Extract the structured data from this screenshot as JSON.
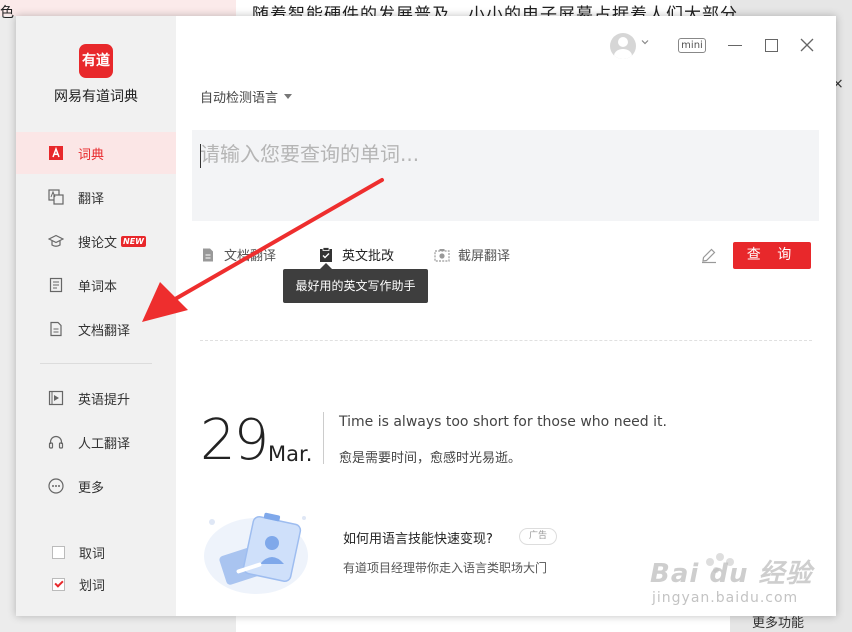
{
  "background": {
    "corner_char": "色",
    "doc_text": "随着智能硬件的发展普及，小小的电子屏幕占据着人们大部分",
    "right_x": "×",
    "bottom_right": "更多功能"
  },
  "app": {
    "logo_text": "有道",
    "name": "网易有道词典"
  },
  "sidebar": {
    "items": [
      {
        "label": "词典",
        "icon": "dictionary-icon"
      },
      {
        "label": "翻译",
        "icon": "translate-icon"
      },
      {
        "label": "搜论文",
        "icon": "graduation-cap-icon",
        "badge": "NEW"
      },
      {
        "label": "单词本",
        "icon": "wordbook-icon"
      },
      {
        "label": "文档翻译",
        "icon": "document-icon"
      },
      {
        "label": "英语提升",
        "icon": "play-book-icon"
      },
      {
        "label": "人工翻译",
        "icon": "headset-icon"
      },
      {
        "label": "更多",
        "icon": "more-icon"
      }
    ],
    "checks": [
      {
        "label": "取词",
        "checked": false
      },
      {
        "label": "划词",
        "checked": true
      }
    ]
  },
  "header": {
    "mini_label": "mini"
  },
  "main": {
    "language_select": "自动检测语言",
    "search_placeholder": "请输入您要查询的单词...",
    "tools": [
      "文档翻译",
      "英文批改",
      "截屏翻译"
    ],
    "query_button": "查 询",
    "tooltip": "最好用的英文写作助手",
    "daily": {
      "day": "29",
      "month": "Mar.",
      "quote_en": "Time is always too short for those who need it.",
      "quote_cn": "愈是需要时间，愈感时光易逝。"
    },
    "promo": {
      "title": "如何用语言技能快速变现?",
      "ad_tag": "广告",
      "subtitle": "有道项目经理带你走入语言类职场大门"
    }
  },
  "watermark": {
    "text": "Bai du 经验",
    "url": "jingyan.baidu.com"
  },
  "colors": {
    "accent": "#e8282b",
    "sidebar_bg": "#f1f1f1",
    "active_bg": "#fbe6e6"
  }
}
